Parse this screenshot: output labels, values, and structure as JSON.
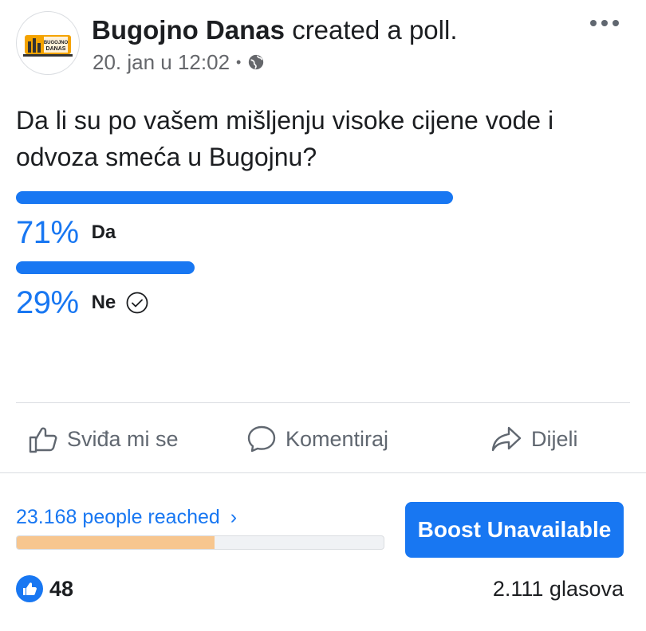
{
  "post": {
    "page_name": "Bugojno Danas",
    "action": "created a poll.",
    "timestamp": "20. jan u 12:02",
    "audience_icon": "globe-icon",
    "more_icon": "more-icon",
    "avatar_logo_text": [
      "BUGOJNO",
      "DANAS"
    ]
  },
  "poll": {
    "question": "Da li su po vašem mišljenju visoke cijene vode i odvoza smeća u Bugojnu?",
    "options": [
      {
        "percent_label": "71%",
        "label": "Da",
        "percent": 71,
        "selected": false
      },
      {
        "percent_label": "29%",
        "label": "Ne",
        "percent": 29,
        "selected": true
      }
    ],
    "bar_color": "#1877f2"
  },
  "actions": {
    "like": "Sviđa mi se",
    "comment": "Komentiraj",
    "share": "Dijeli"
  },
  "insights": {
    "reach": "23.168 people reached",
    "reach_fraction": 0.54,
    "boost_label": "Boost Unavailable"
  },
  "footer": {
    "likes": "48",
    "votes": "2.111 glasova"
  },
  "colors": {
    "accent": "#1877f2",
    "reach_bar": "#f7c68f",
    "muted": "#65676b"
  }
}
